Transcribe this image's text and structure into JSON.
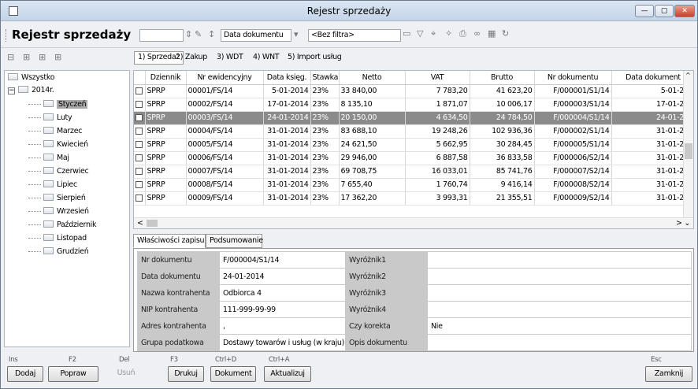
{
  "window": {
    "title": "Rejestr sprzedaży",
    "controls": [
      "—",
      "▢",
      "✕"
    ]
  },
  "toolbar": {
    "title": "Rejestr sprzedaży",
    "search_value": "",
    "sort_value": "Data dokumentu",
    "filter_value": "<Bez filtra>"
  },
  "tabs": [
    "1) Sprzedaż",
    "2) Zakup",
    "3) WDT",
    "4) WNT",
    "5) Import usług"
  ],
  "tree": {
    "root": "Wszystko",
    "year": "2014r.",
    "year_toggle": "−",
    "months": [
      "Styczeń",
      "Luty",
      "Marzec",
      "Kwiecień",
      "Maj",
      "Czerwiec",
      "Lipiec",
      "Sierpień",
      "Wrzesień",
      "Październik",
      "Listopad",
      "Grudzień"
    ],
    "selected_month": 0
  },
  "grid": {
    "columns": [
      "",
      "Dziennik",
      "Nr ewidencyjny",
      "Data księg.",
      "Stawka",
      "Netto",
      "VAT",
      "Brutto",
      "Nr dokumentu",
      "Data dokument"
    ],
    "rows": [
      [
        "SPRP",
        "00001/FS/14",
        "5-01-2014",
        "23%",
        "33 840,00",
        "7 783,20",
        "41 623,20",
        "F/000001/S1/14",
        "5-01-201"
      ],
      [
        "SPRP",
        "00002/FS/14",
        "17-01-2014",
        "23%",
        "8 135,10",
        "1 871,07",
        "10 006,17",
        "F/000003/S1/14",
        "17-01-201"
      ],
      [
        "SPRP",
        "00003/FS/14",
        "24-01-2014",
        "23%",
        "20 150,00",
        "4 634,50",
        "24 784,50",
        "F/000004/S1/14",
        "24-01-201"
      ],
      [
        "SPRP",
        "00004/FS/14",
        "31-01-2014",
        "23%",
        "83 688,10",
        "19 248,26",
        "102 936,36",
        "F/000002/S1/14",
        "31-01-201"
      ],
      [
        "SPRP",
        "00005/FS/14",
        "31-01-2014",
        "23%",
        "24 621,50",
        "5 662,95",
        "30 284,45",
        "F/000005/S1/14",
        "31-01-201"
      ],
      [
        "SPRP",
        "00006/FS/14",
        "31-01-2014",
        "23%",
        "29 946,00",
        "6 887,58",
        "36 833,58",
        "F/000006/S2/14",
        "31-01-201"
      ],
      [
        "SPRP",
        "00007/FS/14",
        "31-01-2014",
        "23%",
        "69 708,75",
        "16 033,01",
        "85 741,76",
        "F/000007/S2/14",
        "31-01-201"
      ],
      [
        "SPRP",
        "00008/FS/14",
        "31-01-2014",
        "23%",
        "7 655,40",
        "1 760,74",
        "9 416,14",
        "F/000008/S2/14",
        "31-01-201"
      ],
      [
        "SPRP",
        "00009/FS/14",
        "31-01-2014",
        "23%",
        "17 362,20",
        "3 993,31",
        "21 355,51",
        "F/000009/S2/14",
        "31-01-201"
      ]
    ],
    "selected_row": 2,
    "scroll_left": "<",
    "scroll_right": "> ⌄",
    "scroll_up": "^"
  },
  "panel_tabs": [
    "Właściwości zapisu",
    "Podsumowanie"
  ],
  "props": [
    [
      "Nr dokumentu",
      "F/000004/S1/14",
      "Wyróżnik1",
      ""
    ],
    [
      "Data dokumentu",
      "24-01-2014",
      "Wyróżnik2",
      ""
    ],
    [
      "Nazwa kontrahenta",
      "Odbiorca 4",
      "Wyróżnik3",
      ""
    ],
    [
      "NIP kontrahenta",
      "111-999-99-99",
      "Wyróżnik4",
      ""
    ],
    [
      "Adres kontrahenta",
      ",",
      "Czy korekta",
      "Nie"
    ],
    [
      "Grupa podatkowa",
      "Dostawy towarów i usług (w kraju)",
      "Opis dokumentu",
      ""
    ]
  ],
  "buttons": [
    {
      "hotkey": "Ins",
      "label": "Dodaj",
      "disabled": false
    },
    {
      "hotkey": "F2",
      "label": "Popraw",
      "disabled": false
    },
    {
      "hotkey": "Del",
      "label": "Usuń",
      "disabled": true
    },
    {
      "hotkey": "F3",
      "label": "Drukuj",
      "disabled": false
    },
    {
      "hotkey": "Ctrl+D",
      "label": "Dokument",
      "disabled": false
    },
    {
      "hotkey": "Ctrl+A",
      "label": "Aktualizuj",
      "disabled": false
    },
    {
      "hotkey": "Esc",
      "label": "Zamknij",
      "disabled": false
    }
  ],
  "colors": {
    "selection": "#8b8b8b",
    "tree_selection": "#a9a9a9",
    "title_bar": "#c4d4e8"
  }
}
